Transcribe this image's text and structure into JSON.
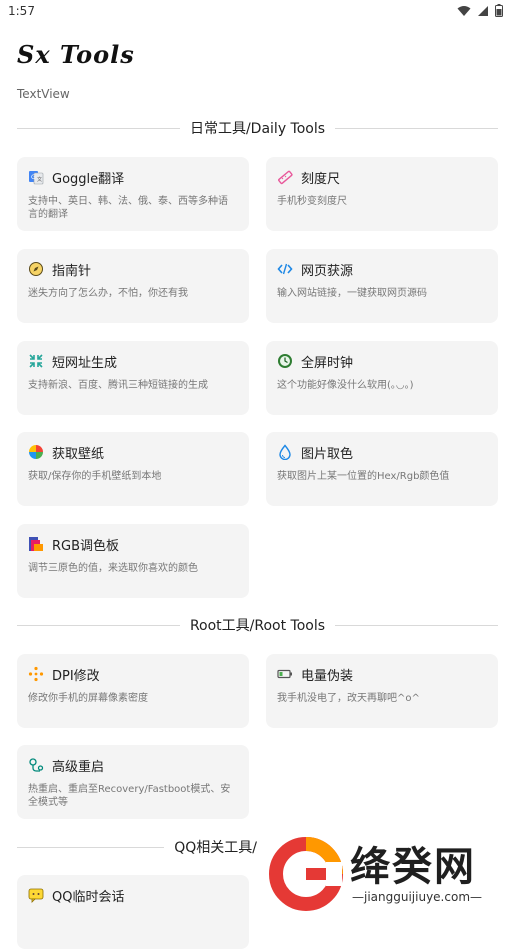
{
  "status_bar": {
    "time": "1:57"
  },
  "app": {
    "title": "Sx Tools",
    "subtitle": "TextView"
  },
  "sections": {
    "daily": "日常工具/Daily Tools",
    "root": "Root工具/Root Tools",
    "qq": "QQ相关工具/"
  },
  "daily_tools": [
    {
      "title": "Goggle翻译",
      "desc": "支持中、英日、韩、法、俄、泰、西等多种语言的翻译",
      "icon": "translate-icon"
    },
    {
      "title": "刻度尺",
      "desc": "手机秒变刻度尺",
      "icon": "ruler-icon"
    },
    {
      "title": "指南针",
      "desc": "迷失方向了怎么办，不怕，你还有我",
      "icon": "compass-icon"
    },
    {
      "title": "网页获源",
      "desc": "输入网站链接，一键获取网页源码",
      "icon": "code-icon"
    },
    {
      "title": "短网址生成",
      "desc": "支持新浪、百度、腾讯三种短链接的生成",
      "icon": "shorten-link-icon"
    },
    {
      "title": "全屏时钟",
      "desc": "这个功能好像没什么软用(｡◡｡)",
      "icon": "clock-icon"
    },
    {
      "title": "获取壁纸",
      "desc": "获取/保存你的手机壁纸到本地",
      "icon": "wallpaper-icon"
    },
    {
      "title": "图片取色",
      "desc": "获取图片上某一位置的Hex/Rgb颜色值",
      "icon": "color-drop-icon"
    },
    {
      "title": "RGB调色板",
      "desc": "调节三原色的值，来选取你喜欢的颜色",
      "icon": "palette-icon"
    }
  ],
  "root_tools": [
    {
      "title": "DPI修改",
      "desc": "修改你手机的屏幕像素密度",
      "icon": "dpi-icon"
    },
    {
      "title": "电量伪装",
      "desc": "我手机没电了，改天再聊吧^o^",
      "icon": "battery-low-icon"
    },
    {
      "title": "高级重启",
      "desc": "热重启、重启至Recovery/Fastboot模式、安全模式等",
      "icon": "restart-icon"
    }
  ],
  "qq_tools": [
    {
      "title": "QQ临时会话",
      "icon": "chat-icon"
    }
  ],
  "watermark": {
    "name": "绛癸网",
    "url": "—jiangguijiuye.com—"
  },
  "colors": {
    "card_bg": "#f4f4f4",
    "divider": "#d9d9d9",
    "accent_blue": "#4285f4"
  }
}
